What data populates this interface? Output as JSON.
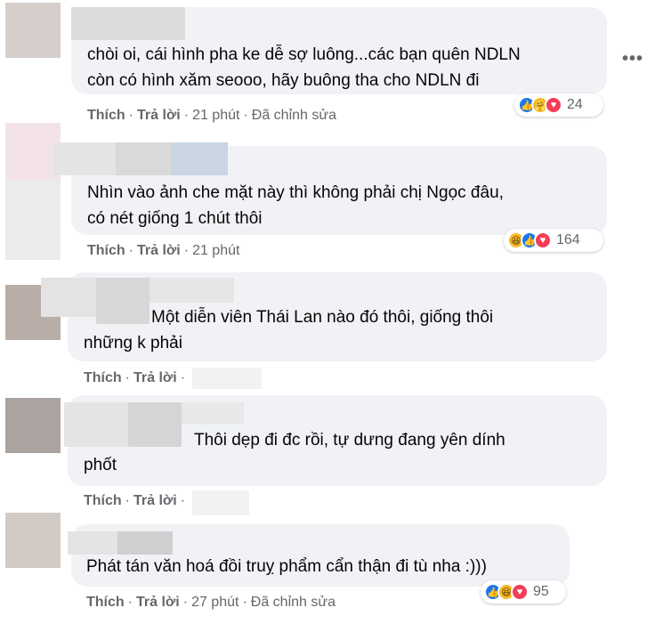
{
  "comments": [
    {
      "text_lines": [
        "chòi oi, cái hình pha ke dễ sợ luông...các bạn quên NDLN",
        "còn có hình xăm seooo, hãy buông tha cho NDLN đi"
      ],
      "like": "Thích",
      "reply": "Trả lời",
      "time": "21 phút",
      "edited": "Đã chỉnh sửa",
      "reactions": [
        "like",
        "care",
        "love"
      ],
      "reaction_count": "24"
    },
    {
      "text_lines": [
        "Nhìn vào ảnh che mặt này thì không phải chị Ngọc đâu,",
        "có nét giống 1 chút thôi"
      ],
      "like": "Thích",
      "reply": "Trả lời",
      "time": "21 phút",
      "reactions": [
        "haha",
        "like",
        "love"
      ],
      "reaction_count": "164"
    },
    {
      "text_lines": [
        "Một diễn viên Thái Lan nào đó thôi, giống thôi",
        "những k phải"
      ],
      "like": "Thích",
      "reply": "Trả lời"
    },
    {
      "text_lines": [
        "Thôi dẹp đi đc rồi, tự dưng đang yên dính",
        "phốt"
      ],
      "like": "Thích",
      "reply": "Trả lời"
    },
    {
      "text_lines": [
        "Phát tán văn hoá đồi truỵ phẩm cẩn thận đi tù nha :)))"
      ],
      "like": "Thích",
      "reply": "Trả lời",
      "time": "27 phút",
      "edited": "Đã chỉnh sửa",
      "reactions": [
        "like",
        "haha",
        "love"
      ],
      "reaction_count": "95"
    }
  ],
  "more_icon": "more-options-icon",
  "colors": {
    "bubble": "#f0f2f5",
    "meta_text": "#65676b",
    "like_blue": "#1877f2",
    "love_red": "#f33e58",
    "haha_yellow": "#f7b928"
  }
}
